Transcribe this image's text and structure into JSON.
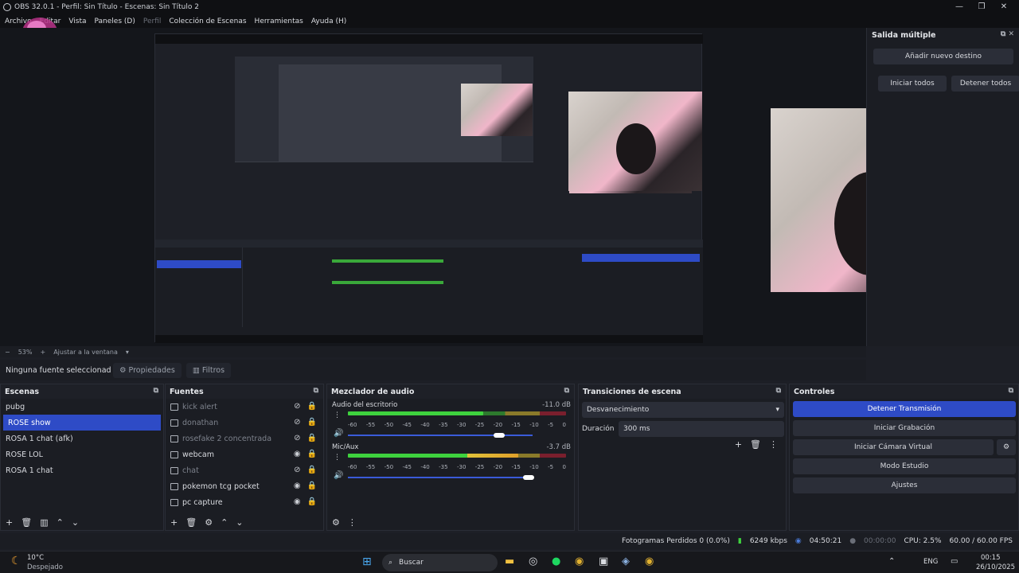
{
  "window": {
    "title": "OBS 32.0.1 - Perfil: Sin Título - Escenas: Sin Título 2",
    "minimize": "—",
    "maximize": "❐",
    "close": "✕"
  },
  "menu": [
    "Archivo",
    "Editar",
    "Vista",
    "Paneles (D)",
    "Perfil",
    "Colección de Escenas",
    "Herramientas",
    "Ayuda (H)"
  ],
  "multi_output": {
    "title": "Salida múltiple",
    "add_target": "Añadir nuevo destino",
    "start_all": "Iniciar todos",
    "stop_all": "Detener todos"
  },
  "zoom": {
    "minus": "−",
    "level": "53%",
    "plus": "+",
    "fit": "Ajustar a la ventana"
  },
  "source_toolbar": {
    "no_source": "Ninguna fuente seleccionad",
    "properties": "Propiedades",
    "filters": "Filtros"
  },
  "scenes": {
    "title": "Escenas",
    "items": [
      "pubg",
      "ROSE show",
      "ROSA 1 chat (afk)",
      "ROSE LOL",
      "ROSA 1 chat"
    ],
    "selected": 1
  },
  "sources": {
    "title": "Fuentes",
    "items": [
      {
        "name": "kick alert",
        "visible": false
      },
      {
        "name": "donathan",
        "visible": false
      },
      {
        "name": "rosefake 2 concentrada",
        "visible": false
      },
      {
        "name": "webcam",
        "visible": true
      },
      {
        "name": "chat",
        "visible": false
      },
      {
        "name": "pokemon tcg pocket",
        "visible": true
      },
      {
        "name": "pc capture",
        "visible": true
      }
    ]
  },
  "mixer": {
    "title": "Mezclador de audio",
    "channels": [
      {
        "name": "Audio del escritorio",
        "db": "-11.0 dB",
        "level": 0.62,
        "volume": 0.82
      },
      {
        "name": "Mic/Aux",
        "db": "-3.7 dB",
        "level": 0.78,
        "volume": 0.98
      }
    ],
    "scale": [
      "-60",
      "-55",
      "-50",
      "-45",
      "-40",
      "-35",
      "-30",
      "-25",
      "-20",
      "-15",
      "-10",
      "-5",
      "0"
    ]
  },
  "transitions": {
    "title": "Transiciones de escena",
    "type": "Desvanecimiento",
    "duration_label": "Duración",
    "duration": "300 ms"
  },
  "controls": {
    "title": "Controles",
    "stop_stream": "Detener Transmisión",
    "start_record": "Iniciar Grabación",
    "virtual_cam": "Iniciar Cámara Virtual",
    "studio": "Modo Estudio",
    "settings": "Ajustes"
  },
  "status": {
    "dropped": "Fotogramas Perdidos 0 (0.0%)",
    "kbps": "6249 kbps",
    "live_time": "04:50:21",
    "rec_time": "00:00:00",
    "cpu": "CPU: 2.5%",
    "fps": "60.00 / 60.00 FPS"
  },
  "taskbar": {
    "temp": "10°C",
    "weather": "Despejado",
    "search": "Buscar",
    "lang": "ENG",
    "time": "00:15",
    "date": "26/10/2025"
  },
  "colors": {
    "accent": "#2e4bc6",
    "bg": "#1b1d23"
  }
}
